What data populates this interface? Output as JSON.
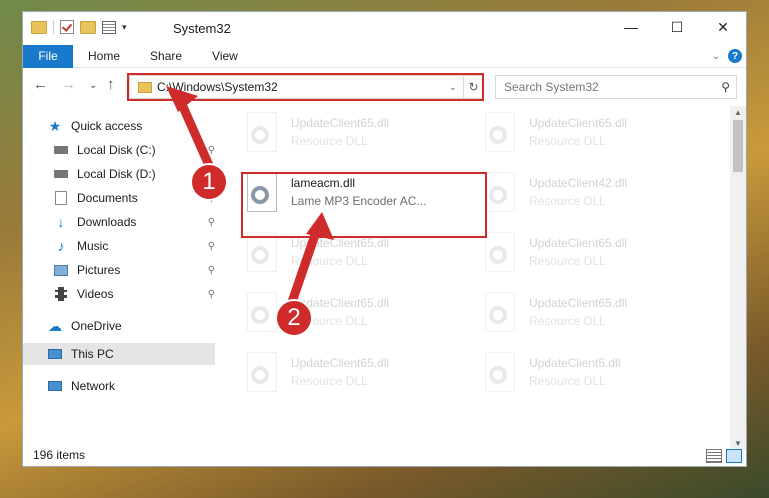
{
  "window": {
    "title": "System32"
  },
  "window_controls": {
    "minimize": "—",
    "maximize": "☐",
    "close": "✕"
  },
  "ribbon": {
    "tabs": [
      "File",
      "Home",
      "Share",
      "View"
    ],
    "help": "?",
    "collapse": "⌄"
  },
  "nav": {
    "back": "←",
    "forward": "→",
    "recent": "⌄",
    "up": "↑",
    "address": "C:\\Windows\\System32",
    "refresh": "↻",
    "search_placeholder": "Search System32",
    "search_icon": "⚲"
  },
  "sidebar": {
    "items": [
      {
        "label": "Quick access",
        "icon": "star-icon",
        "pinned": false
      },
      {
        "label": "Local Disk (C:)",
        "icon": "drive-icon",
        "pinned": true
      },
      {
        "label": "Local Disk (D:)",
        "icon": "drive-icon",
        "pinned": true
      },
      {
        "label": "Documents",
        "icon": "documents-icon",
        "pinned": true
      },
      {
        "label": "Downloads",
        "icon": "download-icon",
        "pinned": true
      },
      {
        "label": "Music",
        "icon": "music-icon",
        "pinned": true
      },
      {
        "label": "Pictures",
        "icon": "pictures-icon",
        "pinned": true
      },
      {
        "label": "Videos",
        "icon": "videos-icon",
        "pinned": true
      },
      {
        "label": "OneDrive",
        "icon": "cloud-icon",
        "pinned": false
      },
      {
        "label": "This PC",
        "icon": "computer-icon",
        "pinned": false
      },
      {
        "label": "Network",
        "icon": "network-icon",
        "pinned": false
      }
    ],
    "pin_glyph": "📌"
  },
  "files": [
    {
      "name": "UpdateClient65.dll",
      "desc": "Resource DLL",
      "faded": true
    },
    {
      "name": "UpdateClient65.dll",
      "desc": "Resource DLL",
      "faded": true
    },
    {
      "name": "lameacm.dll",
      "desc": "Lame MP3 Encoder AC...",
      "faded": false
    },
    {
      "name": "UpdateClient42.dll",
      "desc": "Resource DLL",
      "faded": true
    },
    {
      "name": "UpdateClient65.dll",
      "desc": "Resource DLL",
      "faded": true
    },
    {
      "name": "UpdateClient65.dll",
      "desc": "Resource DLL",
      "faded": true
    },
    {
      "name": "UpdateClient65.dll",
      "desc": "Resource DLL",
      "faded": true
    },
    {
      "name": "UpdateClient65.dll",
      "desc": "Resource DLL",
      "faded": true
    },
    {
      "name": "UpdateClient65.dll",
      "desc": "Resource DLL",
      "faded": true
    },
    {
      "name": "UpdateClient5.dll",
      "desc": "Resource DLL",
      "faded": true
    }
  ],
  "status": {
    "items": "196 items"
  },
  "annotations": {
    "step1": "1",
    "step2": "2",
    "color": "#d02b2b"
  },
  "colors": {
    "accent": "#1979ca",
    "highlight": "#d02b2b"
  }
}
